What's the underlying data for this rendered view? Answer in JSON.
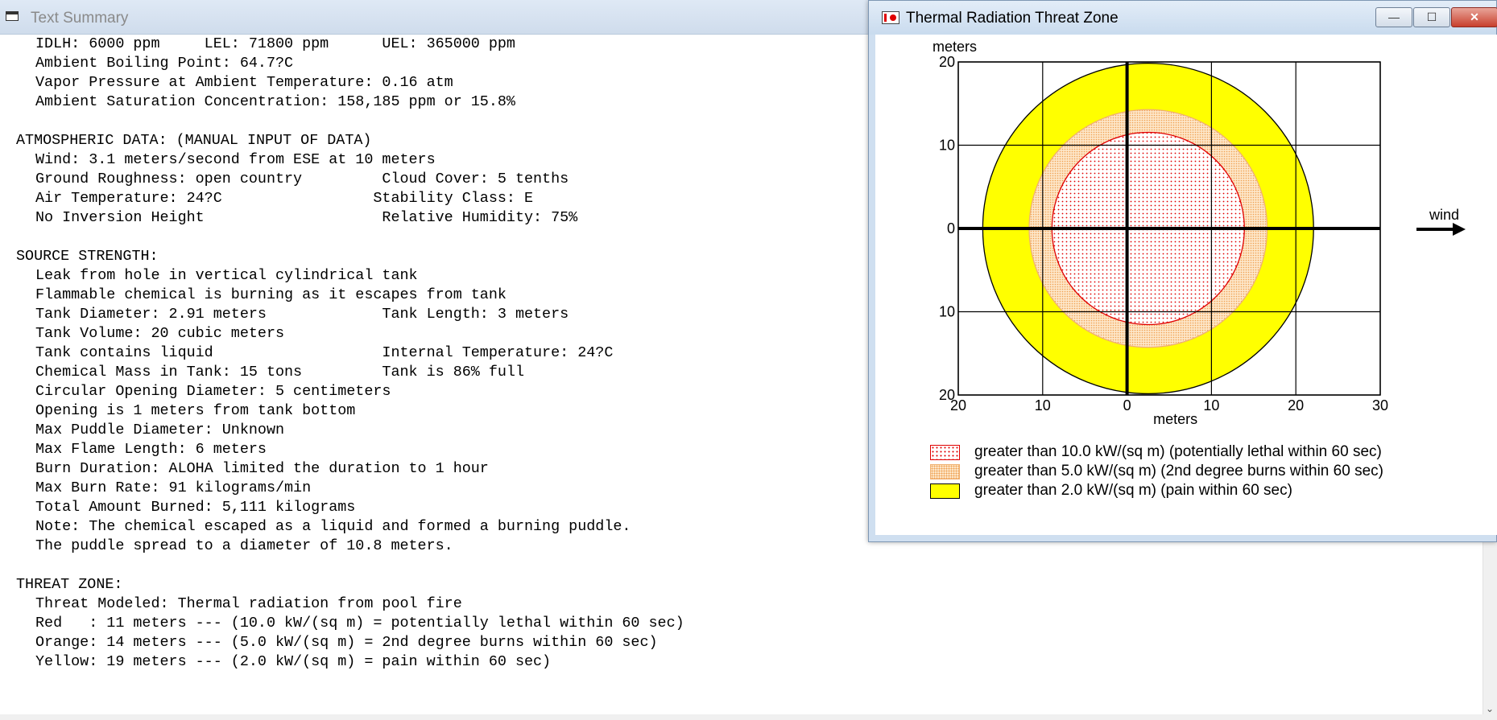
{
  "text_summary": {
    "title": "Text Summary",
    "lines": [
      "IDLH: 6000 ppm     LEL: 71800 ppm      UEL: 365000 ppm",
      "Ambient Boiling Point: 64.7?C",
      "Vapor Pressure at Ambient Temperature: 0.16 atm",
      "Ambient Saturation Concentration: 158,185 ppm or 15.8%",
      "",
      "ATMOSPHERIC DATA: (MANUAL INPUT OF DATA)",
      "Wind: 3.1 meters/second from ESE at 10 meters",
      "Ground Roughness: open country         Cloud Cover: 5 tenths",
      "Air Temperature: 24?C                 Stability Class: E",
      "No Inversion Height                    Relative Humidity: 75%",
      "",
      "SOURCE STRENGTH:",
      "Leak from hole in vertical cylindrical tank",
      "Flammable chemical is burning as it escapes from tank",
      "Tank Diameter: 2.91 meters             Tank Length: 3 meters",
      "Tank Volume: 20 cubic meters",
      "Tank contains liquid                   Internal Temperature: 24?C",
      "Chemical Mass in Tank: 15 tons         Tank is 86% full",
      "Circular Opening Diameter: 5 centimeters",
      "Opening is 1 meters from tank bottom",
      "Max Puddle Diameter: Unknown",
      "Max Flame Length: 6 meters",
      "Burn Duration: ALOHA limited the duration to 1 hour",
      "Max Burn Rate: 91 kilograms/min",
      "Total Amount Burned: 5,111 kilograms",
      "Note: The chemical escaped as a liquid and formed a burning puddle.",
      "The puddle spread to a diameter of 10.8 meters.",
      "",
      "THREAT ZONE:",
      "Threat Modeled: Thermal radiation from pool fire",
      "Red   : 11 meters --- (10.0 kW/(sq m) = potentially lethal within 60 sec)",
      "Orange: 14 meters --- (5.0 kW/(sq m) = 2nd degree burns within 60 sec)",
      "Yellow: 19 meters --- (2.0 kW/(sq m) = pain within 60 sec)"
    ],
    "indented": [
      true,
      true,
      true,
      true,
      false,
      false,
      true,
      true,
      true,
      true,
      false,
      false,
      true,
      true,
      true,
      true,
      true,
      true,
      true,
      true,
      true,
      true,
      true,
      true,
      true,
      true,
      true,
      false,
      false,
      true,
      true,
      true,
      true
    ]
  },
  "threat_zone_window": {
    "title": "Thermal Radiation Threat Zone",
    "buttons": {
      "minimize": "—",
      "maximize": "☐",
      "close": "✕"
    }
  },
  "chart_data": {
    "type": "threat-zone-plot",
    "x_axis_label": "meters",
    "y_axis_label": "meters",
    "x_ticks": [
      "20",
      "10",
      "0",
      "10",
      "20",
      "30"
    ],
    "x_tick_values": [
      -20,
      -10,
      0,
      10,
      20,
      30
    ],
    "y_ticks": [
      "20",
      "10",
      "0",
      "10",
      "20"
    ],
    "y_tick_values": [
      20,
      10,
      0,
      -10,
      -20
    ],
    "xlim": [
      -20,
      30
    ],
    "ylim": [
      -20,
      20
    ],
    "grid": true,
    "wind_label": "wind",
    "wind_direction": "right",
    "zones": [
      {
        "name": "yellow",
        "center_x": 2.5,
        "radius": 19.6,
        "fill": "#ffff00",
        "stroke": "#000000"
      },
      {
        "name": "orange",
        "center_x": 2.5,
        "radius": 14.1,
        "fill": "#fde6c8",
        "stroke": "#f0b070"
      },
      {
        "name": "red",
        "center_x": 2.5,
        "radius": 11.4,
        "fill": "#ffffff",
        "stroke": "#e00000"
      }
    ],
    "legend": [
      {
        "id": "red",
        "label": "greater than 10.0 kW/(sq m) (potentially lethal within 60 sec)"
      },
      {
        "id": "orange",
        "label": "greater than 5.0 kW/(sq m) (2nd degree burns within 60 sec)"
      },
      {
        "id": "yellow",
        "label": "greater than 2.0 kW/(sq m) (pain within 60 sec)"
      }
    ]
  }
}
